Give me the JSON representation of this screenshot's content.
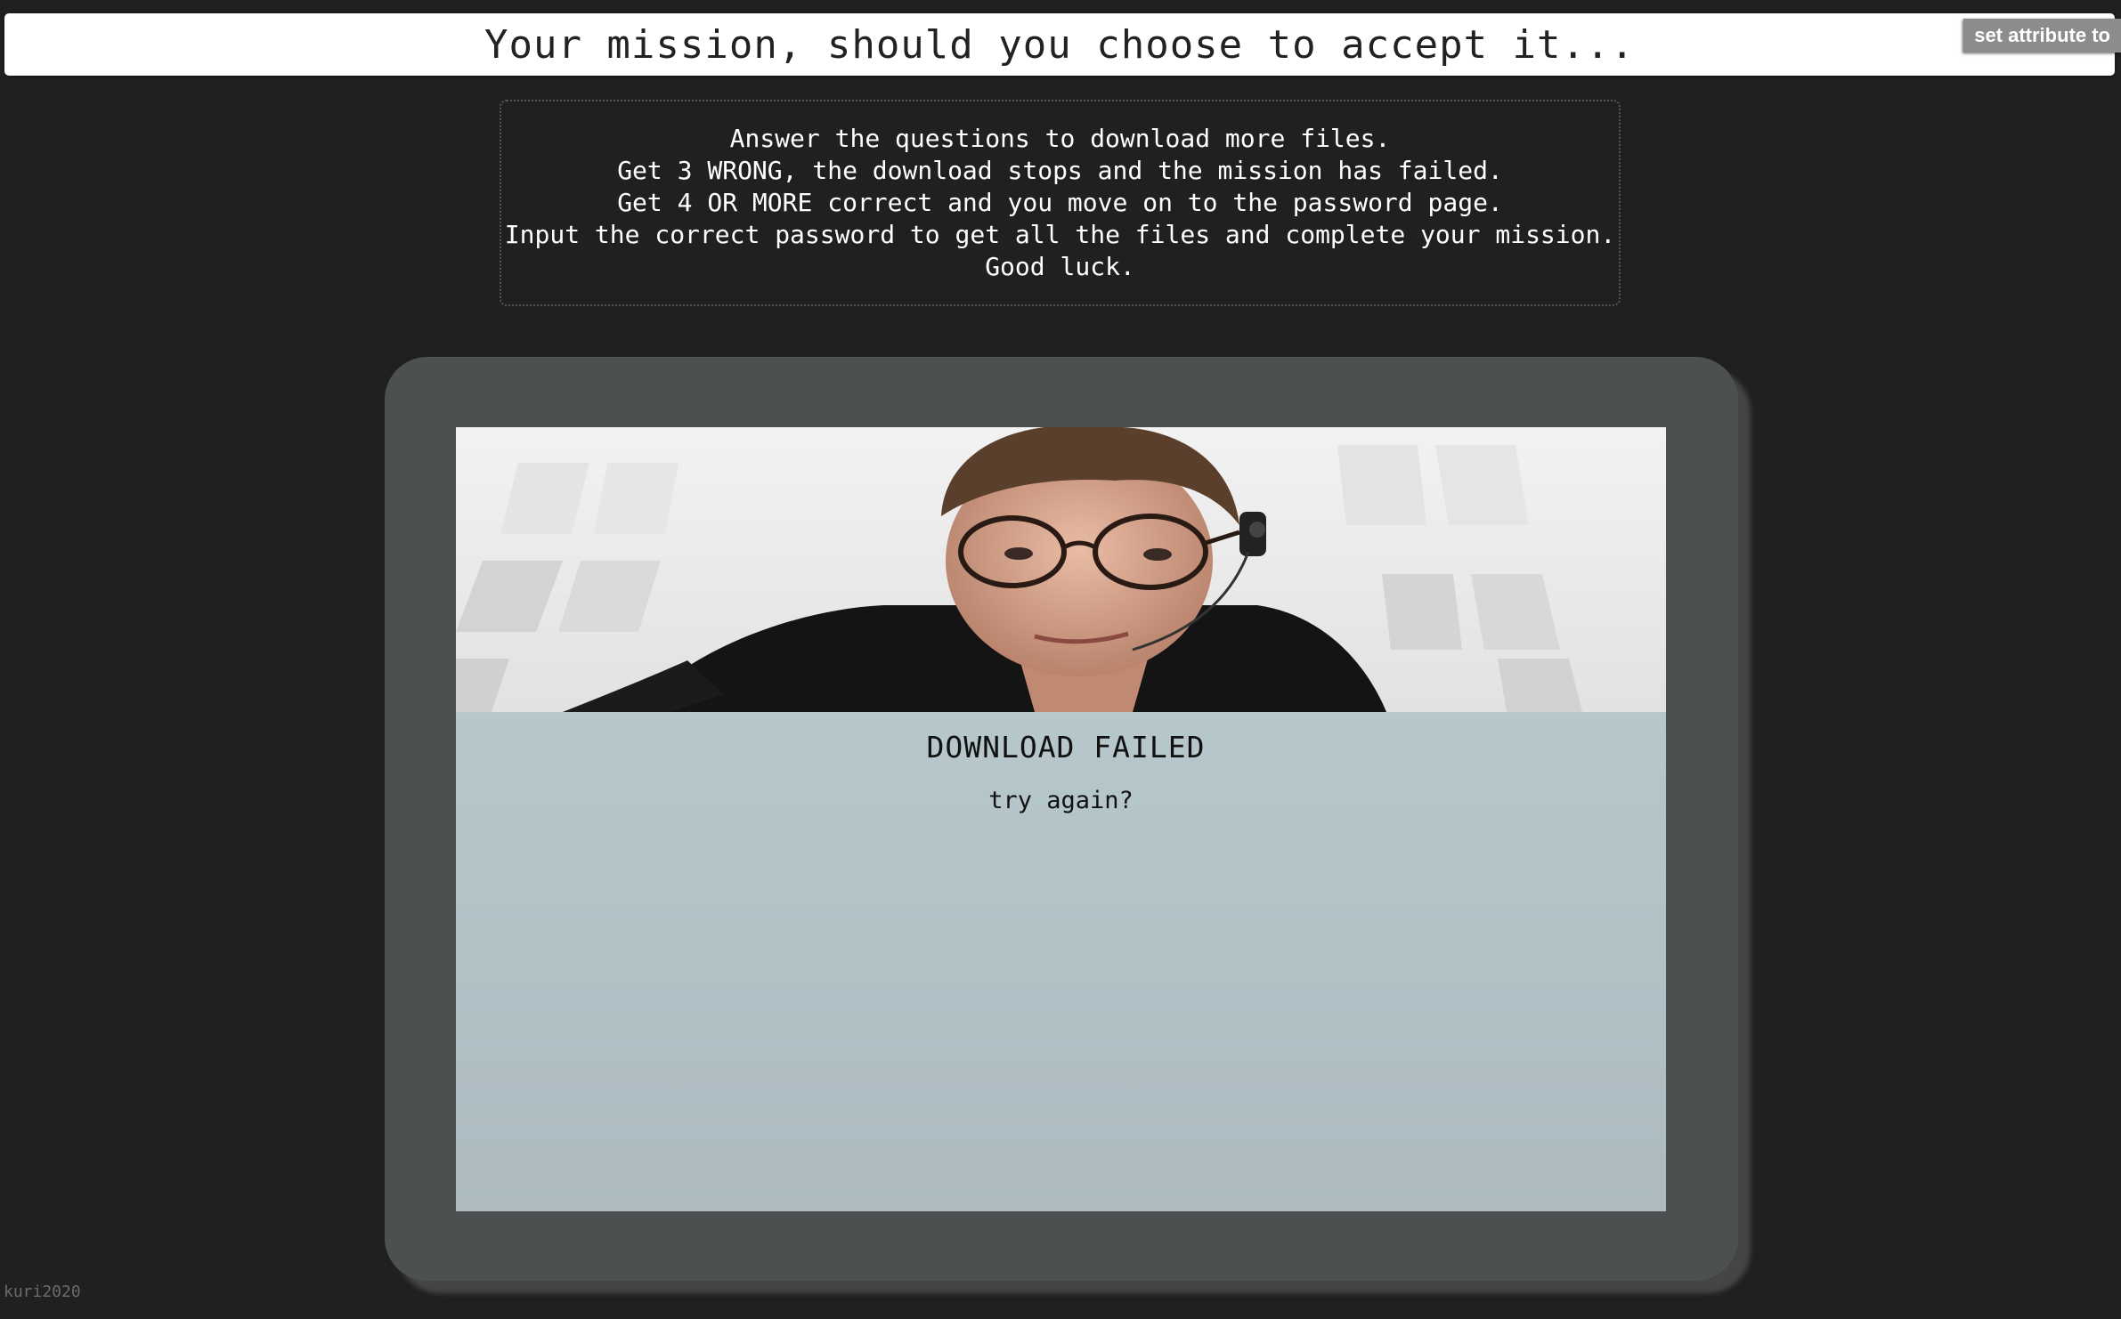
{
  "header": {
    "title": "Your mission, should you choose to accept it...",
    "set_attribute_label": "set attribute to"
  },
  "instructions": {
    "lines": [
      "Answer the questions to download more files.",
      "Get 3 WRONG, the download stops and the mission has failed.",
      "Get 4 OR MORE correct and you move on to the password page.",
      "Input the correct password to get all the files and complete your mission.",
      "Good luck."
    ]
  },
  "result": {
    "status": "DOWNLOAD FAILED",
    "retry": "try again?"
  },
  "footer": {
    "credit": "kuri2020"
  },
  "colors": {
    "page_background": "#202020",
    "device_frame": "#4d5051",
    "screen_background": "#bccfd2"
  },
  "icons": {
    "hero": "agent-photo"
  }
}
